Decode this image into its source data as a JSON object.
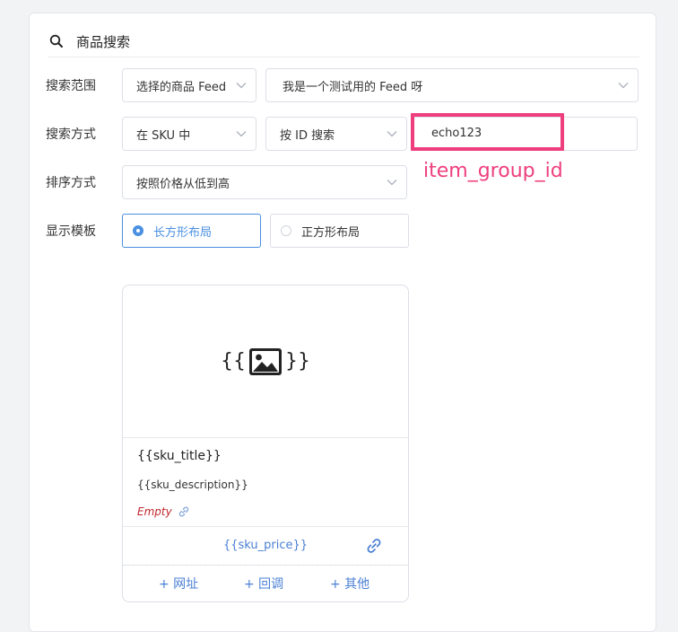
{
  "header": {
    "title": "商品搜索",
    "icon": "search-icon"
  },
  "search_scope": {
    "label": "搜索范围",
    "feed_select": "选择的商品 Feed",
    "feed_value": "我是一个测试用的 Feed 呀"
  },
  "search_method": {
    "label": "搜索方式",
    "scope_select": "在 SKU 中",
    "by_select": "按 ID 搜索",
    "input_value": "echo123"
  },
  "annotation": {
    "text": "item_group_id",
    "color": "#ee3e7e"
  },
  "sort": {
    "label": "排序方式",
    "value": "按照价格从低到高"
  },
  "display_template": {
    "label": "显示模板",
    "options": [
      {
        "label": "长方形布局",
        "selected": true
      },
      {
        "label": "正方形布局",
        "selected": false
      }
    ]
  },
  "card": {
    "brace_open": "{{",
    "brace_close": "}}",
    "image_icon": "image-icon",
    "title": "{{sku_title}}",
    "description": "{{sku_description}}",
    "empty": "Empty",
    "price": "{{sku_price}}",
    "actions": [
      "+ 网址",
      "+ 回调",
      "+ 其他"
    ]
  },
  "colors": {
    "accent": "#4a90e2",
    "link": "#4a7fd4",
    "highlight": "#ee3e7e",
    "empty_text": "#c0262d"
  }
}
